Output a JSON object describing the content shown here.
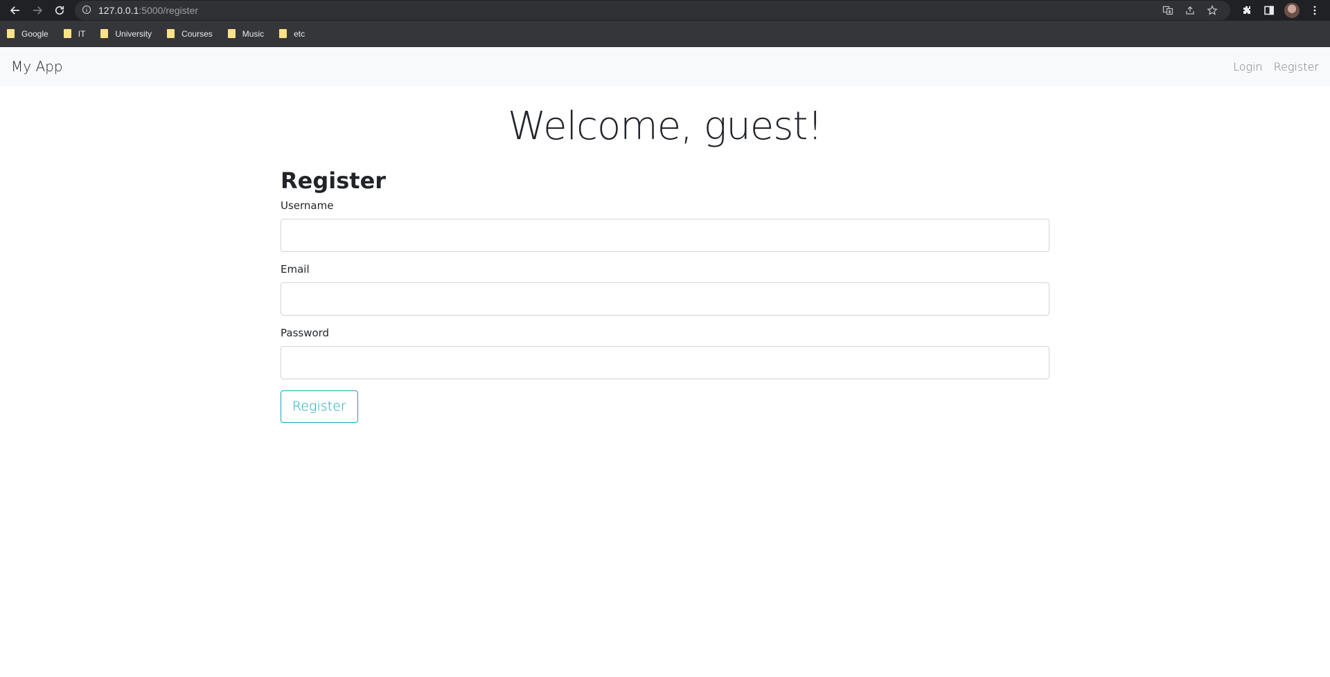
{
  "browser": {
    "url_host": "127.0.0.1",
    "url_path": ":5000/register",
    "bookmarks": [
      {
        "label": "Google"
      },
      {
        "label": "IT"
      },
      {
        "label": "University"
      },
      {
        "label": "Courses"
      },
      {
        "label": "Music"
      },
      {
        "label": "etc"
      }
    ]
  },
  "navbar": {
    "brand": "My App",
    "links": [
      "Login",
      "Register"
    ]
  },
  "main": {
    "welcome": "Welcome, guest!",
    "form_title": "Register",
    "fields": [
      {
        "label": "Username",
        "value": ""
      },
      {
        "label": "Email",
        "value": ""
      },
      {
        "label": "Password",
        "value": ""
      }
    ],
    "submit_label": "Register"
  },
  "colors": {
    "accent": "#17a2b8",
    "navbar_bg": "#f8f9fa",
    "chrome_bg": "#202124"
  }
}
